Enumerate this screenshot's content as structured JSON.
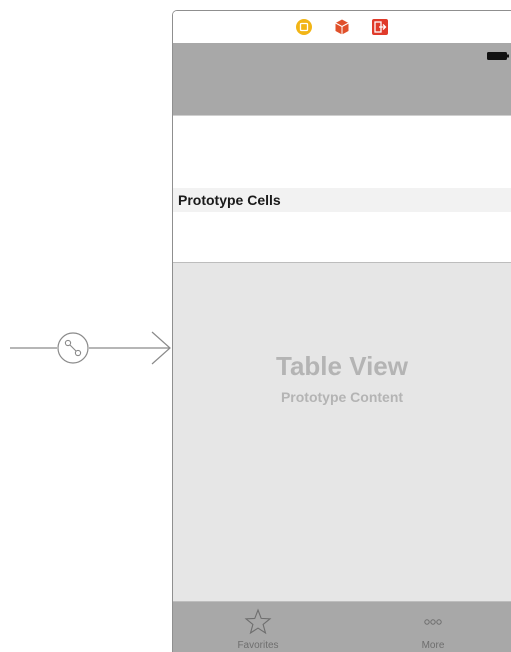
{
  "scene": {
    "dock_icons": [
      "view-controller-icon",
      "first-responder-icon",
      "exit-icon"
    ],
    "status_bar": {
      "battery_icon": "battery-icon"
    },
    "section_header": "Prototype Cells",
    "table_placeholder": {
      "title": "Table View",
      "subtitle": "Prototype Content"
    },
    "tab_bar": {
      "items": [
        {
          "label": "Favorites",
          "icon": "star-icon"
        },
        {
          "label": "More",
          "icon": "more-icon"
        }
      ]
    }
  },
  "segue": {
    "icon": "segue-icon"
  },
  "colors": {
    "navbar": "#a8a8a8",
    "table_background": "#e6e6e6",
    "view_controller_icon": "#f2b516",
    "first_responder_icon": "#e0502a",
    "exit_icon": "#e03a2a"
  }
}
